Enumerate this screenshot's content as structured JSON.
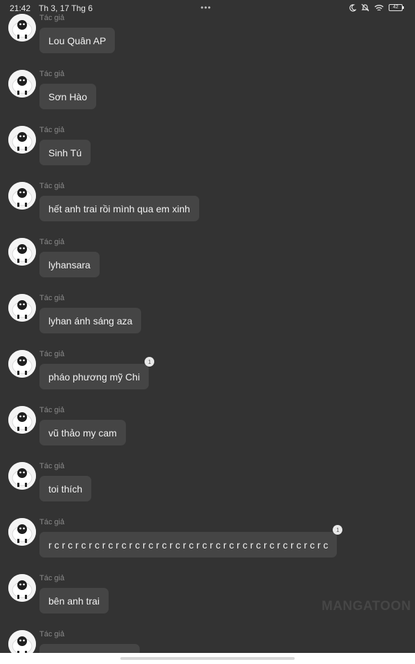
{
  "status_bar": {
    "time": "21:42",
    "date": "Th 3, 17 Thg 6",
    "menu_dots": "•••",
    "battery": "42"
  },
  "messages": [
    {
      "author": "Tác giả",
      "text": "Lou Quân AP"
    },
    {
      "author": "Tác giả",
      "text": "Sơn Hào"
    },
    {
      "author": "Tác giả",
      "text": "Sinh Tú"
    },
    {
      "author": "Tác giả",
      "text": "hết anh trai rồi mình qua em xinh"
    },
    {
      "author": "Tác giả",
      "text": "lyhansara"
    },
    {
      "author": "Tác giả",
      "text": "lyhan ánh sáng aza"
    },
    {
      "author": "Tác giả",
      "text": "pháo phương mỹ Chi",
      "badge": "1"
    },
    {
      "author": "Tác giả",
      "text": "vũ thảo my cam"
    },
    {
      "author": "Tác giả",
      "text": "toi thích"
    },
    {
      "author": "Tác giả",
      "text": "r c r c r c r c r c r c r c r c r c r c r c r c r c r c r c r c r c r c r c r c r c",
      "badge": "1"
    },
    {
      "author": "Tác giả",
      "text": "bên anh trai"
    },
    {
      "author": "Tác giả",
      "text": ""
    }
  ],
  "watermark": "MANGATOON",
  "colors": {
    "background": "#333333",
    "bubble": "#454545",
    "author": "#8a8a8a"
  }
}
